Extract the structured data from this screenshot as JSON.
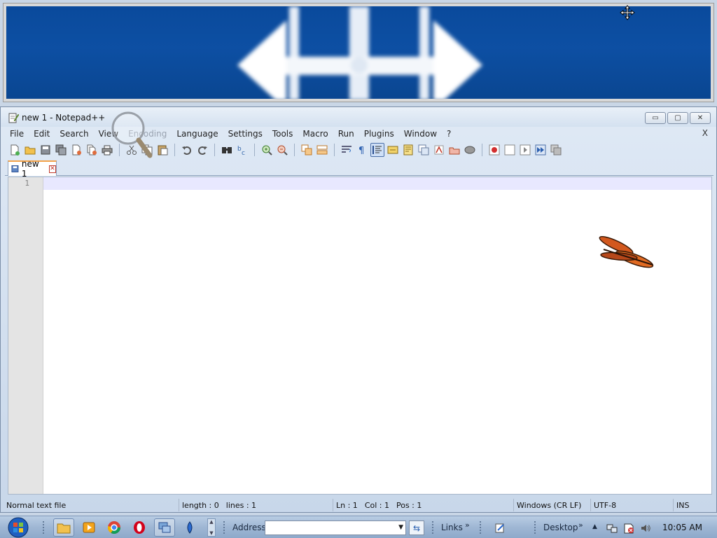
{
  "window": {
    "title": "new 1 - Notepad++",
    "controls": {
      "minimize": "▭",
      "restore": "▢",
      "close": "✕"
    }
  },
  "menu": {
    "items": [
      "File",
      "Edit",
      "Search",
      "View",
      "Encoding",
      "Language",
      "Settings",
      "Tools",
      "Macro",
      "Run",
      "Plugins",
      "Window",
      "?"
    ],
    "close_label": "X"
  },
  "toolbar": {
    "icons": [
      "new-file-icon",
      "open-file-icon",
      "save-icon",
      "save-all-icon",
      "close-icon",
      "close-all-icon",
      "print-icon",
      "cut-icon",
      "copy-icon",
      "paste-icon",
      "undo-icon",
      "redo-icon",
      "find-icon",
      "replace-icon",
      "zoom-in-icon",
      "zoom-out-icon",
      "sync-vertical-icon",
      "sync-horizontal-icon",
      "word-wrap-icon",
      "show-all-chars-icon",
      "indent-guide-icon",
      "user-lang-icon",
      "doc-map-icon",
      "function-list-icon",
      "folder-workspace-icon",
      "monitor-icon",
      "record-macro-icon",
      "stop-record-icon",
      "play-macro-icon",
      "run-multiple-icon",
      "save-macro-icon"
    ]
  },
  "tabs": [
    {
      "label": "new 1",
      "close": "✕"
    }
  ],
  "editor": {
    "line_numbers": [
      "1"
    ]
  },
  "status": {
    "file_type": "Normal text file",
    "length": "length : 0",
    "lines": "lines : 1",
    "ln": "Ln : 1",
    "col": "Col : 1",
    "pos": "Pos : 1",
    "eol": "Windows (CR LF)",
    "encoding": "UTF-8",
    "mode": "INS"
  },
  "taskbar": {
    "address_label": "Address",
    "address_value": "",
    "links_label": "Links",
    "desktop_label": "Desktop",
    "chevron": "»",
    "clock": "10:05 AM",
    "pinned": [
      "explorer-icon",
      "media-player-icon",
      "chrome-icon",
      "opera-icon",
      "network-icon",
      "app-icon"
    ]
  },
  "colors": {
    "banner_blue": "#0d4fa3",
    "current_line": "#e8e8ff",
    "gutter": "#e4e4e4"
  }
}
